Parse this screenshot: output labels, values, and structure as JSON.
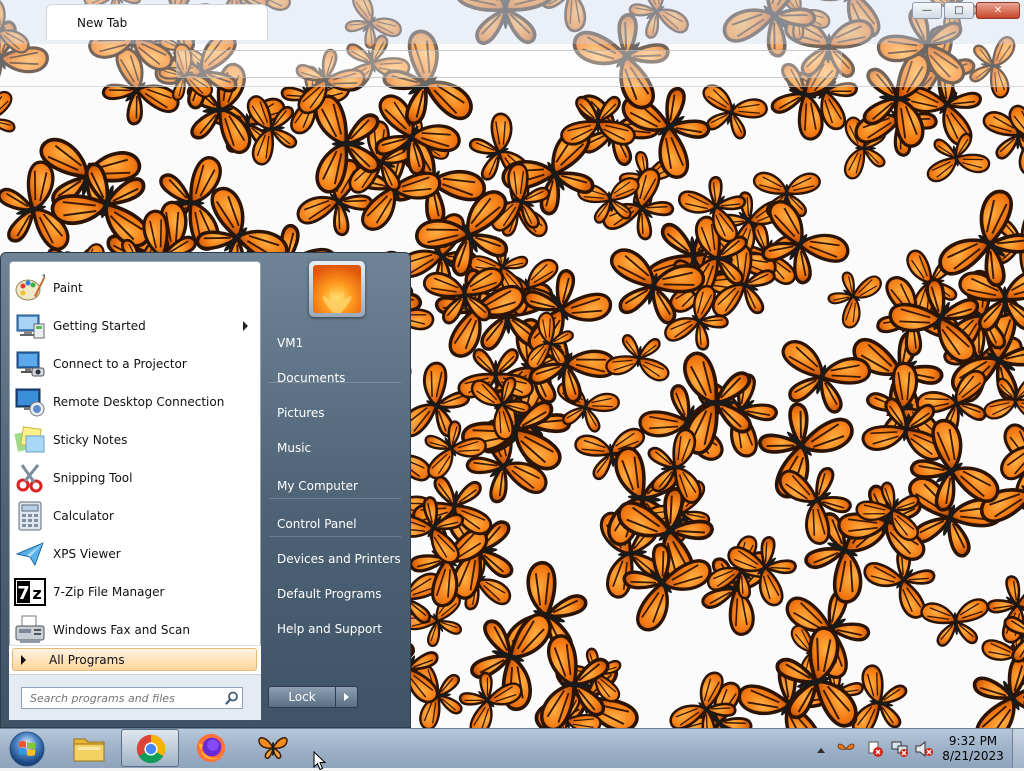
{
  "browser": {
    "tab_title": "New Tab",
    "window_buttons": {
      "minimize": "minimize",
      "maximize": "maximize",
      "close": "close"
    }
  },
  "start_menu": {
    "programs": [
      {
        "label": "Paint",
        "icon": "paint-icon",
        "has_submenu": false
      },
      {
        "label": "Getting Started",
        "icon": "getting-started-icon",
        "has_submenu": true
      },
      {
        "label": "Connect to a Projector",
        "icon": "projector-icon",
        "has_submenu": false
      },
      {
        "label": "Remote Desktop Connection",
        "icon": "remote-desktop-icon",
        "has_submenu": false
      },
      {
        "label": "Sticky Notes",
        "icon": "sticky-notes-icon",
        "has_submenu": false
      },
      {
        "label": "Snipping Tool",
        "icon": "snipping-tool-icon",
        "has_submenu": false
      },
      {
        "label": "Calculator",
        "icon": "calculator-icon",
        "has_submenu": false
      },
      {
        "label": "XPS Viewer",
        "icon": "xps-viewer-icon",
        "has_submenu": false
      },
      {
        "label": "7-Zip File Manager",
        "icon": "7zip-icon",
        "has_submenu": false
      },
      {
        "label": "Windows Fax and Scan",
        "icon": "fax-scan-icon",
        "has_submenu": false
      }
    ],
    "all_programs_label": "All Programs",
    "search_placeholder": "Search programs and files",
    "right_items": [
      {
        "label": "VM1"
      },
      {
        "label": "Documents"
      },
      {
        "label": "Pictures"
      },
      {
        "label": "Music"
      },
      {
        "label": "My Computer"
      },
      {
        "label": "Control Panel"
      },
      {
        "label": "Devices and Printers"
      },
      {
        "label": "Default Programs"
      },
      {
        "label": "Help and Support"
      }
    ],
    "lock_label": "Lock"
  },
  "taskbar": {
    "pinned": [
      {
        "name": "file-explorer",
        "icon": "folder-icon",
        "active": false
      },
      {
        "name": "chrome",
        "icon": "chrome-icon",
        "active": true
      },
      {
        "name": "firefox",
        "icon": "firefox-icon",
        "active": false
      },
      {
        "name": "butterflies",
        "icon": "butterfly-icon",
        "active": false
      }
    ],
    "clock_time": "9:32 PM",
    "clock_date": "8/21/2023"
  },
  "colors": {
    "accent": "#f07a10",
    "menu_highlight": "#ffd59a",
    "taskbar": "#9fb3c9"
  }
}
